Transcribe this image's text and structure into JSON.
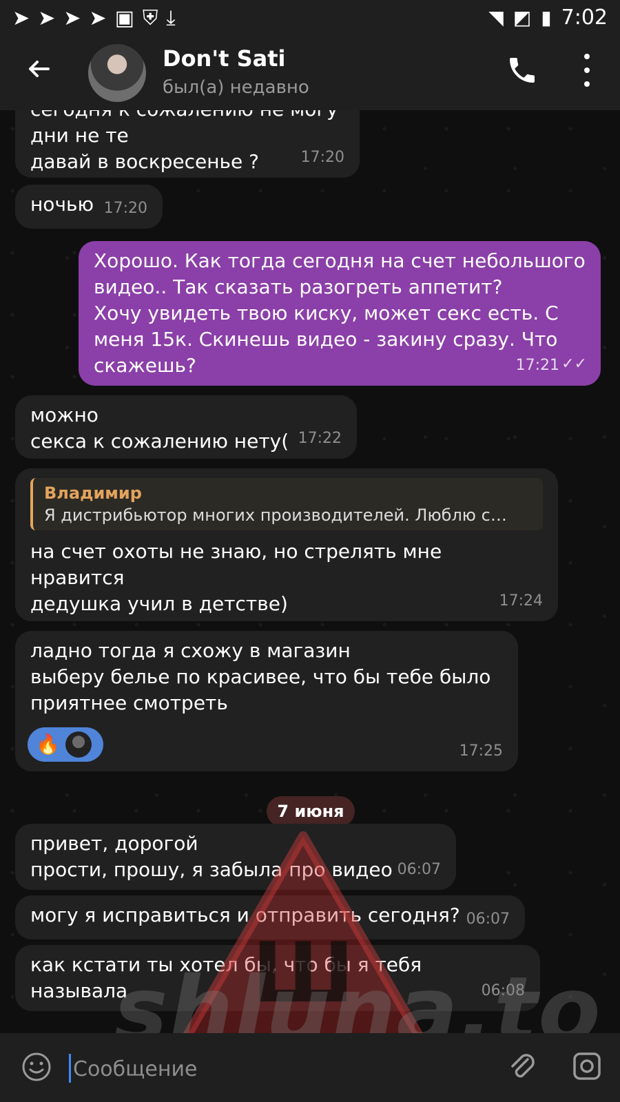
{
  "status_bar": {
    "time": "7:02",
    "left_icons": [
      "send-icon",
      "send-icon",
      "send-icon",
      "send-icon",
      "image-icon",
      "shield-icon",
      "download-icon"
    ],
    "right_icons": [
      "wifi-icon",
      "no-signal-icon",
      "battery-icon"
    ]
  },
  "header": {
    "title": "Don't Sati",
    "subtitle": "был(а) недавно"
  },
  "messages": [
    {
      "text": "сегодня к сожалению не могу\nдни не те\nдавай в воскресенье ?",
      "time": "17:20"
    },
    {
      "text": "ночью",
      "time": "17:20"
    },
    {
      "text": "Хорошо. Как тогда сегодня на счет небольшого\nвидео..  Так сказать разогреть аппетит?\nХочу увидеть твою киску, может секс есть. С\nменя 15к. Скинешь видео - закину сразу. Что\nскажешь?",
      "time": "17:21"
    },
    {
      "text": "можно\nсекса к сожалению нету(",
      "time": "17:22"
    },
    {
      "reply_name": "Владимир",
      "reply_text": "Я дистрибьютор многих производителей.   Люблю с…",
      "text": "на счет охоты не знаю, но стрелять мне\nнравится\nдедушка учил в детстве)",
      "time": "17:24"
    },
    {
      "text": "ладно тогда я схожу в магазин\nвыберу белье по красивее, что бы тебе было\nприятнее смотреть",
      "time": "17:25",
      "reaction": "🔥"
    },
    {
      "text": "привет, дорогой\nпрости, прошу, я забыла про видео",
      "time": "06:07"
    },
    {
      "text": "могу я исправиться и отправить сегодня?",
      "time": "06:07"
    },
    {
      "text": "как кстати ты хотел бы, что бы я тебя называла",
      "time": "06:08"
    }
  ],
  "date_divider": "7 июня",
  "watermark": {
    "letter": "Ш",
    "text": "shluna.to"
  },
  "composer": {
    "placeholder": "Сообщение"
  }
}
